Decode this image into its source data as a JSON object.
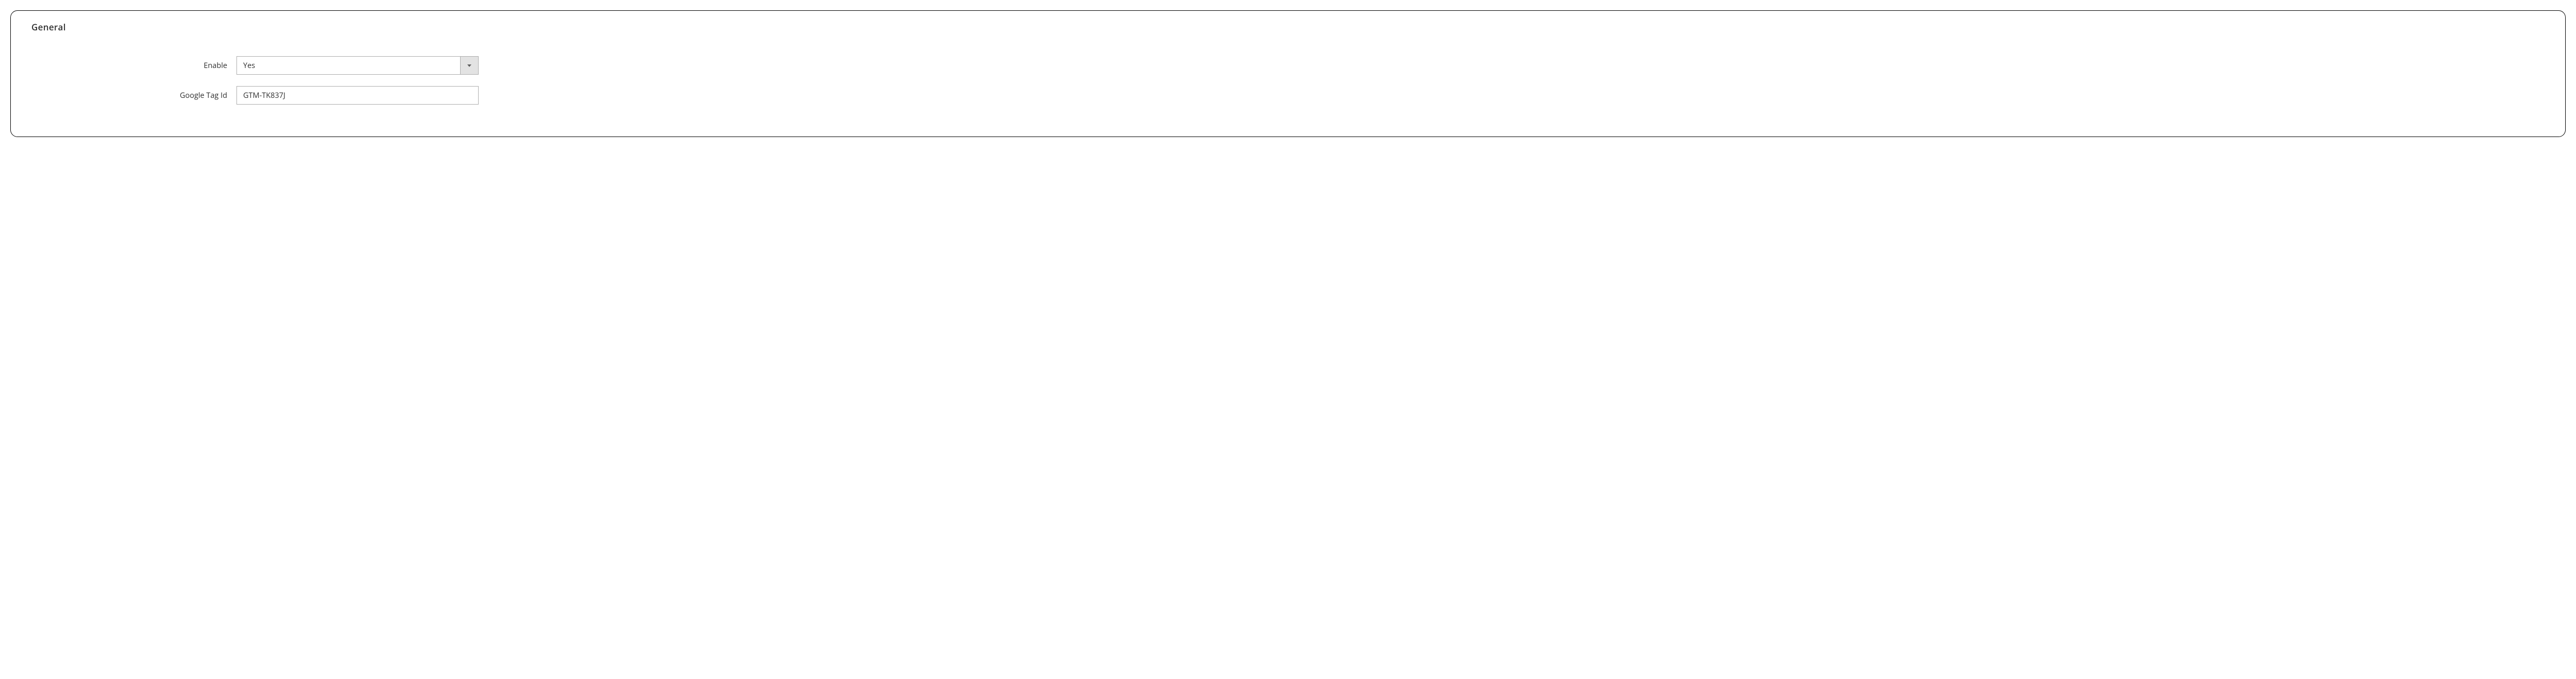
{
  "section": {
    "title": "General",
    "fields": {
      "enable": {
        "label": "Enable",
        "value": "Yes"
      },
      "google_tag_id": {
        "label": "Google Tag Id",
        "value": "GTM-TK837J"
      }
    }
  }
}
